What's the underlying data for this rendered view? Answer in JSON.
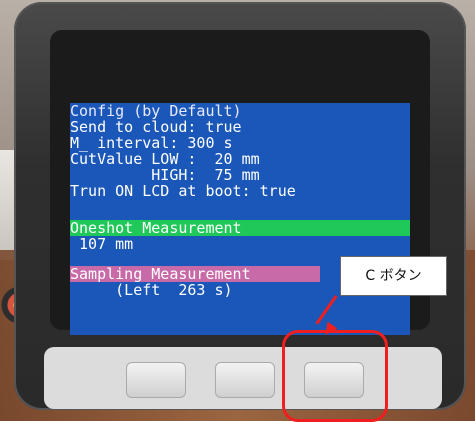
{
  "screen": {
    "title": "Config (by Default)",
    "send_to_cloud": "Send to cloud: true",
    "m_interval": "M_ interval: 300 s",
    "cut_low": "CutValue LOW :  20 mm",
    "cut_high": "         HIGH:  75 mm",
    "lcd_boot": "Trun ON LCD at boot: true",
    "oneshot_label": "Oneshot Measurement",
    "oneshot_value": " 107 mm",
    "sampling_label": "Sampling Measurement",
    "sampling_left": "     (Left  263 s)"
  },
  "annotation": {
    "button_callout": "C ボタン"
  },
  "colors": {
    "screen_bg": "#1a57b8",
    "oneshot_bar": "#20c85a",
    "sampling_bar": "#c86aa8",
    "highlight_red": "#ef1f1f"
  }
}
